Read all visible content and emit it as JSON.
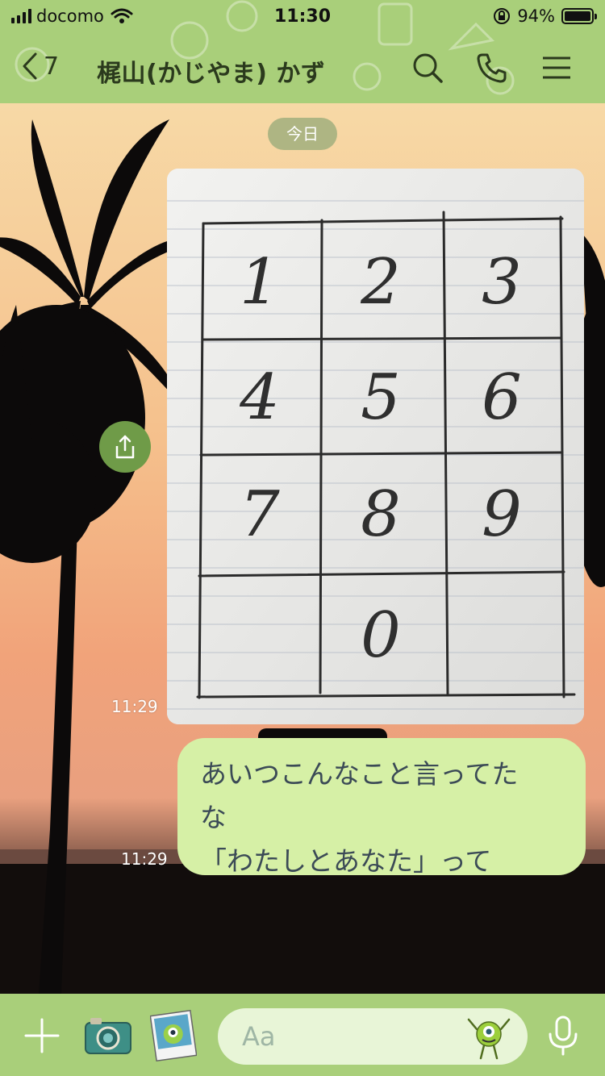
{
  "status_bar": {
    "carrier": "docomo",
    "time": "11:30",
    "battery_percent": "94%"
  },
  "header": {
    "back_count": "7",
    "chat_title": "梶山(かじやま) かず",
    "icons": [
      "search-icon",
      "phone-icon",
      "menu-icon"
    ],
    "color": "#a9cf7a"
  },
  "chat": {
    "date_label": "今日",
    "messages": [
      {
        "type": "image",
        "time": "11:29",
        "grid_digits": [
          [
            "1",
            "2",
            "3"
          ],
          [
            "4",
            "5",
            "6"
          ],
          [
            "7",
            "8",
            "9"
          ],
          [
            "",
            "0",
            ""
          ]
        ]
      },
      {
        "type": "text",
        "time": "11:29",
        "lines": [
          "あいつこんなこと言ってた",
          "な",
          "「わたしとあなた」って"
        ],
        "bubble_color": "#d6f0a6"
      }
    ]
  },
  "composer": {
    "placeholder": "Aa",
    "icons": [
      "plus-icon",
      "camera-icon",
      "sticker-icon",
      "emoji-icon",
      "mic-icon"
    ]
  }
}
